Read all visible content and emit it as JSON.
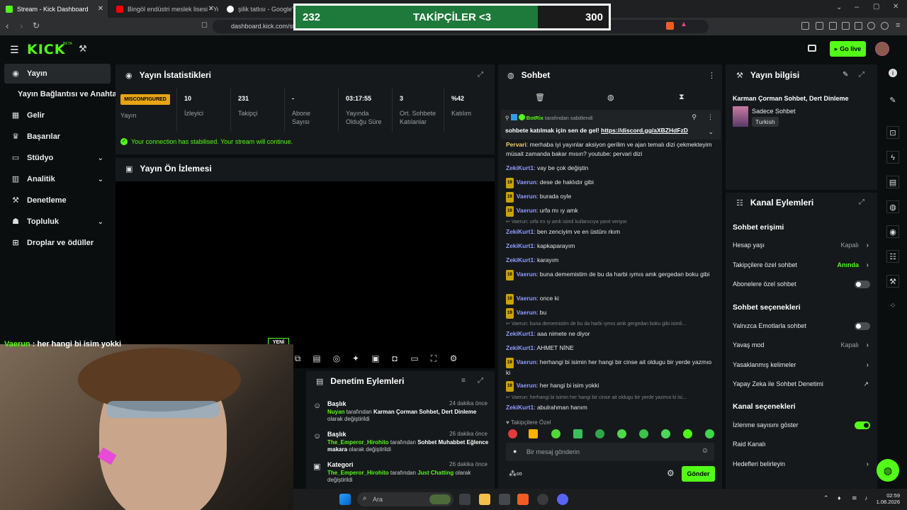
{
  "browser": {
    "tabs": [
      {
        "label": "Stream - Kick Dashboard",
        "active": true
      },
      {
        "label": "Bingöl endüstri meslek lisesi - YouTu",
        "active": false
      },
      {
        "label": "şilik tatlısı - Google'da A",
        "active": false
      }
    ],
    "url": "dashboard.kick.com/st"
  },
  "overlay": {
    "current": "232",
    "label": "TAKİPÇİLER <3",
    "goal": "300",
    "progress": 0.773
  },
  "topnav": {
    "logo": "KICK",
    "logo_sup": "BETA",
    "go_live": "Go live"
  },
  "sidebar": {
    "items": [
      {
        "label": "Yayın"
      },
      {
        "label": "Yayın Bağlantısı ve Anahtarı"
      },
      {
        "label": "Gelir"
      },
      {
        "label": "Başarılar"
      },
      {
        "label": "Stüdyo"
      },
      {
        "label": "Analitik"
      },
      {
        "label": "Denetleme"
      },
      {
        "label": "Topluluk"
      },
      {
        "label": "Droplar ve ödüller"
      }
    ]
  },
  "stats": {
    "title": "Yayın İstatistikleri",
    "status_badge": "MISCONFIGURED",
    "status_label": "Yayın",
    "items": [
      {
        "value": "10",
        "label": "İzleyici"
      },
      {
        "value": "231",
        "label": "Takipçi"
      },
      {
        "value": "-",
        "label": "Abone Sayısı"
      },
      {
        "value": "03:17:55",
        "label": "Yayında Olduğu Süre"
      },
      {
        "value": "3",
        "label": "Ort. Sohbete Katılanlar"
      },
      {
        "value": "%42",
        "label": "Katılım"
      }
    ],
    "notice": "Your connection has stabilised. Your stream will continue."
  },
  "preview": {
    "title": "Yayın Ön İzlemesi"
  },
  "webcam_chat": {
    "user": "Vaerun",
    "text": "her hangi bi isim yokki",
    "new_badge": "YENİ"
  },
  "chat": {
    "title": "Sohbet",
    "pinned": {
      "by": "BotRix",
      "by_suffix": "tarafından sabitlendi",
      "text": "sohbete katılmak için sen de gel!",
      "link": "https://discord.gg/aXBZHdFzD"
    },
    "messages": [
      {
        "user": "Pervari",
        "badge": "",
        "text": "merhaba iyi yayınlar aksiyon gerilim ve ajan temalı dizi çekmekteyim müsait zamanda bakar mısın? youtube: pervari dizi",
        "reply": ""
      },
      {
        "user": "ZekiKurt1",
        "badge": "",
        "text": "vay be çok değiştin",
        "reply": ""
      },
      {
        "user": "Vaerun",
        "badge": "19",
        "text": "dese de haklıdır gibi",
        "reply": ""
      },
      {
        "user": "Vaerun",
        "badge": "19",
        "text": "burada oyle",
        "reply": ""
      },
      {
        "user": "Vaerun",
        "badge": "19",
        "text": "urfa mı ıy amk",
        "reply": ""
      },
      {
        "user": "ZekiKurt1",
        "badge": "",
        "text": "ben zenciyim ve en üstünı rkım",
        "reply": "Vaerun: urfa mı ıy amk isimli kullanıcıya yanıt veriyor"
      },
      {
        "user": "ZekiKurt1",
        "badge": "",
        "text": "kapkaparayım",
        "reply": ""
      },
      {
        "user": "ZekiKurt1",
        "badge": "",
        "text": "karayım",
        "reply": ""
      },
      {
        "user": "Vaerun",
        "badge": "19",
        "text": "buna dememistim de bu da harbi ıymıs amk gergedan boku gibi",
        "reply": ""
      },
      {
        "user": "Vaerun",
        "badge": "19",
        "text": "once ki",
        "reply": ""
      },
      {
        "user": "Vaerun",
        "badge": "19",
        "text": "bu",
        "reply": ""
      },
      {
        "user": "ZekiKurt1",
        "badge": "",
        "text": "aaa nimete ne diyor",
        "reply": "Vaerun: buna dememistim de bu da harbi ıymıs amk gergedan boku gibi isimli..."
      },
      {
        "user": "ZekiKurt1",
        "badge": "",
        "text": "AHMET NİNE",
        "reply": ""
      },
      {
        "user": "Vaerun",
        "badge": "19",
        "text": "herhangi bi isimin her hangi bir cinse ait oldugu bir yerde yazmıo ki",
        "reply": ""
      },
      {
        "user": "Vaerun",
        "badge": "19",
        "text": "her hangi bi isim yokki",
        "reply": ""
      },
      {
        "user": "ZekiKurt1",
        "badge": "",
        "text": "abulrahman hanım",
        "reply": "Vaerun: herhangi bi isimin her hangi bir cinse ait oldugu bir yerde yazmıo ki isi..."
      }
    ],
    "followers_only": "Takipçilere Özel",
    "input_placeholder": "Bir mesaj gönderin",
    "send_label": "Gönder"
  },
  "moderation": {
    "title": "Denetim Eylemleri",
    "items": [
      {
        "type": "Başlık",
        "time": "24 dakika önce",
        "user": "Nuyan",
        "mid": "tarafından",
        "value": "Karman Çorman Sohbet, Dert Dinleme",
        "suffix": "olarak değiştirildi"
      },
      {
        "type": "Başlık",
        "time": "26 dakika önce",
        "user": "The_Emperor_Hirohito",
        "mid": "tarafından",
        "value": "Sohbet Muhabbet Eğlence makara",
        "suffix": "olarak değiştirildi"
      },
      {
        "type": "Kategori",
        "time": "26 dakika önce",
        "user": "The_Emperor_Hirohito",
        "mid": "tarafından",
        "value": "Just Chatting",
        "suffix": "olarak değiştirildi"
      }
    ]
  },
  "stream_info": {
    "title": "Yayın bilgisi",
    "stream_title": "Karman Çorman Sohbet, Dert Dinleme",
    "category": "Sadece Sohbet",
    "language": "Turkish"
  },
  "channel_actions": {
    "title": "Kanal Eylemleri",
    "chat_access": "Sohbet erişimi",
    "account_age": "Hesap yaşı",
    "account_age_val": "Kapalı",
    "followers_chat": "Takipçilere özel sohbet",
    "followers_chat_val": "Anında",
    "subs_chat": "Abonelere özel sohbet",
    "chat_options": "Sohbet seçenekleri",
    "emote_only": "Yalnızca Emotlarla sohbet",
    "slow_mode": "Yavaş mod",
    "slow_mode_val": "Kapalı",
    "banned_words": "Yasaklanmış kelimeler",
    "ai_mod": "Yapay Zeka ile Sohbet Denetimi",
    "channel_options": "Kanal seçenekleri",
    "show_viewers": "İzlenme sayısını göster",
    "raid": "Raid Kanalı",
    "targets": "Hedefleri belirleyin"
  },
  "taskbar": {
    "search": "Ara",
    "time": "02:59",
    "date": "1.08.2026"
  }
}
